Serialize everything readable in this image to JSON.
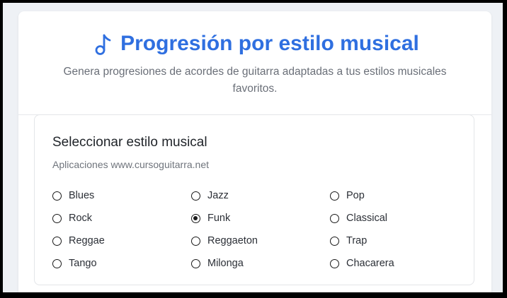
{
  "header": {
    "icon": "music-note-icon",
    "title": "Progresión por estilo musical",
    "subtitle": "Genera progresiones de acordes de guitarra adaptadas a tus estilos musicales favoritos."
  },
  "style_selector": {
    "title": "Seleccionar estilo musical",
    "subtitle": "Aplicaciones www.cursoguitarra.net",
    "selected": "Funk",
    "options": [
      "Blues",
      "Jazz",
      "Pop",
      "Rock",
      "Funk",
      "Classical",
      "Reggae",
      "Reggaeton",
      "Trap",
      "Tango",
      "Milonga",
      "Chacarera"
    ]
  },
  "colors": {
    "accent": "#2f6fe0",
    "text": "#1f2328",
    "muted": "#6a6f78"
  }
}
